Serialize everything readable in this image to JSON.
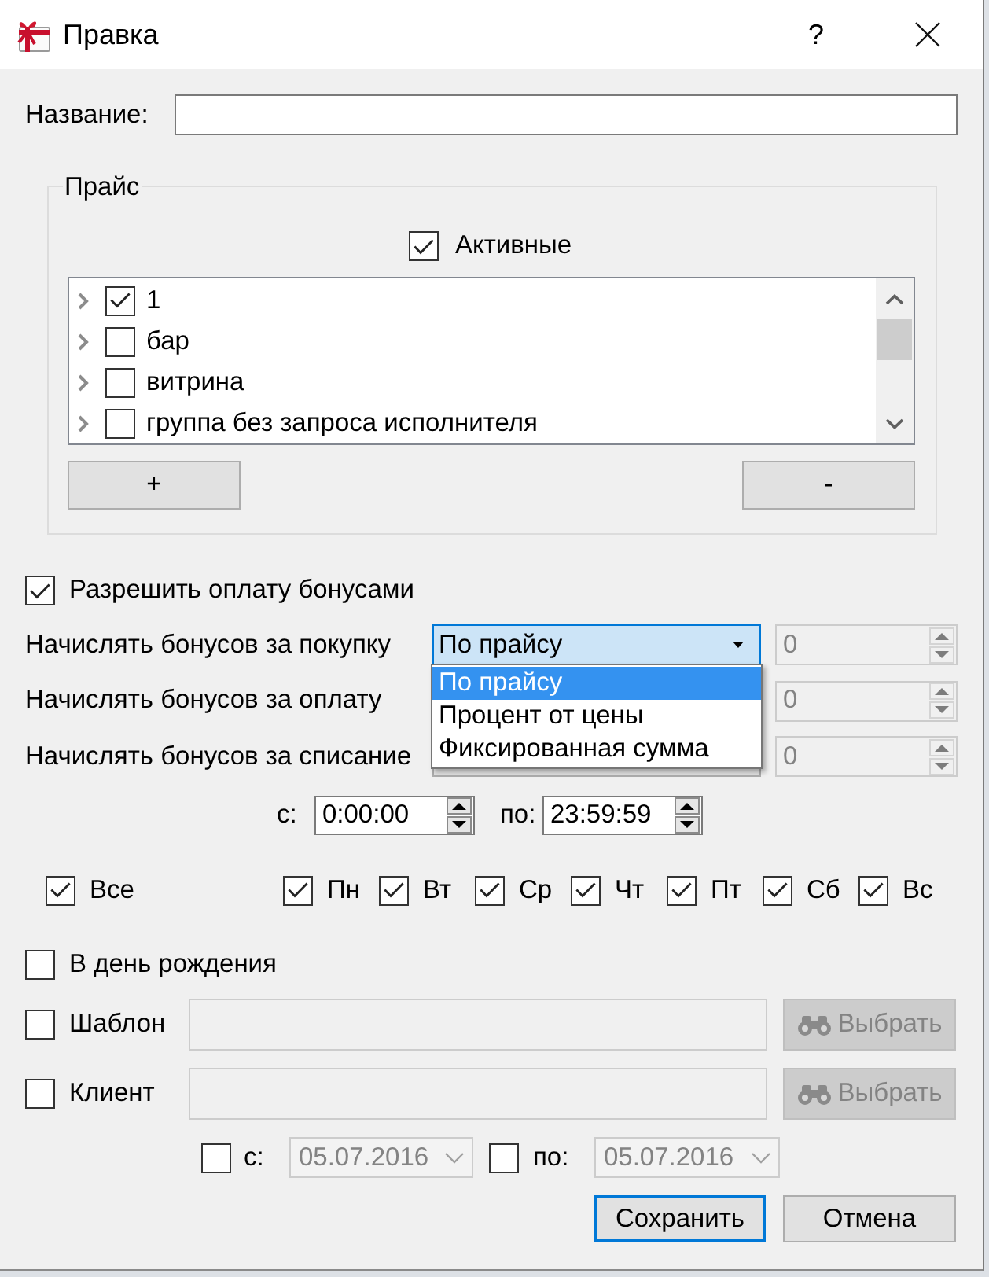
{
  "window": {
    "title": "Правка",
    "help": "?"
  },
  "name_field": {
    "label": "Название:"
  },
  "price_group": {
    "title": "Прайс",
    "active_filter": {
      "label": "Активные",
      "checked": true
    },
    "items": [
      {
        "label": "1",
        "checked": true,
        "expanded": false
      },
      {
        "label": "бар",
        "checked": false,
        "expanded": false
      },
      {
        "label": "витрина",
        "checked": false,
        "expanded": false
      },
      {
        "label": "группа без запроса исполнителя",
        "checked": false,
        "expanded": false
      }
    ],
    "buttons": [
      "+",
      "-"
    ]
  },
  "allow_bonus_payment": {
    "label": "Разрешить оплату бонусами",
    "checked": true
  },
  "accrual_rows": [
    {
      "label": "Начислять бонусов за покупку",
      "mode": "По прайсу",
      "options": [
        {
          "label": "По прайсу",
          "selected": true
        },
        {
          "label": "Процент от цены",
          "selected": false
        },
        {
          "label": "Фиксированная сумма",
          "selected": false
        }
      ],
      "amount": "0",
      "amount_disabled": true
    },
    {
      "label": "Начислять бонусов за оплату",
      "amount": "0",
      "amount_disabled": true
    },
    {
      "label": "Начислять бонусов за списание",
      "amount": "0",
      "amount_disabled": true
    }
  ],
  "time_range": {
    "from_label": "с:",
    "from": "0:00:00",
    "to_label": "по:",
    "to": "23:59:59"
  },
  "days": {
    "all": {
      "label": "Все",
      "checked": true
    },
    "items": [
      {
        "label": "Пн",
        "checked": true
      },
      {
        "label": "Вт",
        "checked": true
      },
      {
        "label": "Ср",
        "checked": true
      },
      {
        "label": "Чт",
        "checked": true
      },
      {
        "label": "Пт",
        "checked": true
      },
      {
        "label": "Сб",
        "checked": true
      },
      {
        "label": "Вс",
        "checked": true
      }
    ]
  },
  "birthday": {
    "label": "В день рождения",
    "checked": false
  },
  "pickers": [
    {
      "label": "Шаблон",
      "checked": false,
      "button": "Выбрать",
      "disabled": true
    },
    {
      "label": "Клиент",
      "checked": false,
      "button": "Выбрать",
      "disabled": true
    }
  ],
  "date_range": [
    {
      "label": "с:",
      "checked": false,
      "value": "05.07.2016",
      "disabled": true
    },
    {
      "label": "по:",
      "checked": false,
      "value": "05.07.2016",
      "disabled": true
    }
  ],
  "buttons": [
    {
      "label": "Сохранить",
      "default": true
    },
    {
      "label": "Отмена",
      "default": false
    }
  ]
}
